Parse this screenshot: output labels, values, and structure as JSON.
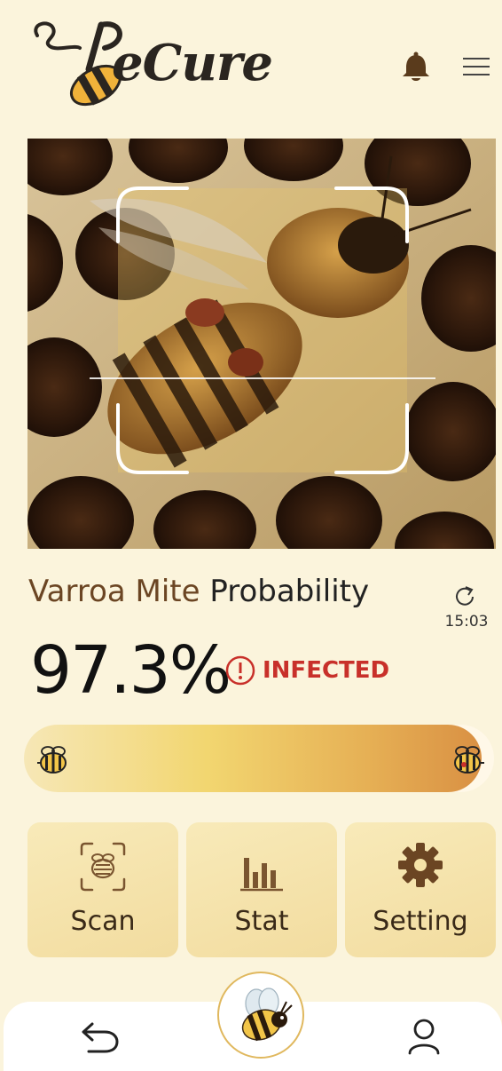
{
  "header": {
    "logo_text": "eCure",
    "notification_icon": "bell-icon",
    "menu_icon": "hamburger-menu-icon"
  },
  "camera": {
    "scan_frame_icon": "scan-frame-icon"
  },
  "result": {
    "title_accent": "Varroa Mite",
    "title_rest": "Probability",
    "refresh_icon": "refresh-icon",
    "time": "15:03",
    "percent": "97.3%",
    "status_icon": "alert-circle-icon",
    "status": "INFECTED",
    "level_percent": 97.3
  },
  "actions": [
    {
      "label": "Scan",
      "icon": "bee-scan-icon"
    },
    {
      "label": "Stat",
      "icon": "bar-chart-icon"
    },
    {
      "label": "Setting",
      "icon": "gear-icon"
    }
  ],
  "bottom_nav": {
    "back_icon": "back-arrow-icon",
    "center_icon": "bee-mascot-icon",
    "profile_icon": "user-icon"
  },
  "colors": {
    "background": "#fbf4dc",
    "brand_brown": "#6b4523",
    "alert_red": "#c8302a",
    "card": "#f5e3a8"
  }
}
